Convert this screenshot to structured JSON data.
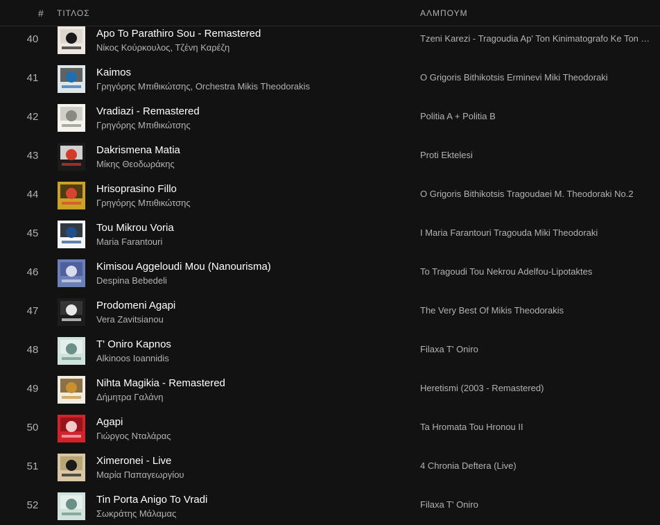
{
  "header": {
    "number": "#",
    "title": "ΤΙΤΛΟΣ",
    "album": "ΑΛΜΠΟΥΜ"
  },
  "tracks": [
    {
      "number": "40",
      "title": "Apo To Parathiro Sou - Remastered",
      "artist": "Νίκος Κούρκουλος, Τζένη Καρέζη",
      "album": "Tzeni Karezi - Tragoudia Ap' Ton Kinimatografo Ke Ton Theatro",
      "cover": {
        "bg": "#ede9e2",
        "accent": "#1a1a1a",
        "band": "#d9d3c9"
      }
    },
    {
      "number": "41",
      "title": "Kaimos",
      "artist": "Γρηγόρης Μπιθικώτσης, Orchestra Mikis Theodorakis",
      "album": "O Grigoris Bithikotsis Erminevi Miki Theodoraki",
      "cover": {
        "bg": "#dfe6ea",
        "accent": "#1f6fb0",
        "band": "#4a4a4a"
      }
    },
    {
      "number": "42",
      "title": "Vradiazi - Remastered",
      "artist": "Γρηγόρης Μπιθικώτσης",
      "album": "Politia A + Politia B",
      "cover": {
        "bg": "#f4f3ee",
        "accent": "#8a8a80",
        "band": "#c9c8c0"
      }
    },
    {
      "number": "43",
      "title": "Dakrismena Matia",
      "artist": "Μίκης Θεοδωράκης",
      "album": "Proti Ektelesi",
      "cover": {
        "bg": "#1b1b1b",
        "accent": "#d23a2a",
        "band": "#f0f0f0"
      }
    },
    {
      "number": "44",
      "title": "Hrisoprasino Fillo",
      "artist": "Γρηγόρης Μπιθικώτσης",
      "album": "O Grigoris Bithikotsis Tragoudaei M. Theodoraki No.2",
      "cover": {
        "bg": "#c9a227",
        "accent": "#d8452e",
        "band": "#3a2a10"
      }
    },
    {
      "number": "45",
      "title": "Tou Mikrou Voria",
      "artist": "Maria Farantouri",
      "album": "I Maria Farantouri Tragouda Miki Theodoraki",
      "cover": {
        "bg": "#f2f4f6",
        "accent": "#1f4f8a",
        "band": "#101820"
      }
    },
    {
      "number": "46",
      "title": "Kimisou Aggeloudi Mou (Nanourisma)",
      "artist": "Despina Bebedeli",
      "album": "To Tragoudi Tou Nekrou Adelfou-Lipotaktes",
      "cover": {
        "bg": "#6b7fb8",
        "accent": "#d9dcea",
        "band": "#4a5b94"
      }
    },
    {
      "number": "47",
      "title": "Prodomeni Agapi",
      "artist": "Vera Zavitsianou",
      "album": "The Very Best Of Mikis Theodorakis",
      "cover": {
        "bg": "#1c1c1c",
        "accent": "#e8e8e8",
        "band": "#3a3a3a"
      }
    },
    {
      "number": "48",
      "title": "T' Oniro Kapnos",
      "artist": "Alkinoos Ioannidis",
      "album": "Filaxa T' Oniro",
      "cover": {
        "bg": "#cfe3dc",
        "accent": "#6a8f86",
        "band": "#e8f1ee"
      }
    },
    {
      "number": "49",
      "title": "Nihta Magikia - Remastered",
      "artist": "Δήμητρα Γαλάνη",
      "album": "Heretismi (2003 - Remastered)",
      "cover": {
        "bg": "#f1ece0",
        "accent": "#c7912e",
        "band": "#7a5a2a"
      }
    },
    {
      "number": "50",
      "title": "Agapi",
      "artist": "Γιώργος Νταλάρας",
      "album": "Ta Hromata Tou Hronou II",
      "cover": {
        "bg": "#d3222c",
        "accent": "#f2c8c8",
        "band": "#8e1218"
      }
    },
    {
      "number": "51",
      "title": "Ximeronei - Live",
      "artist": "Μαρία Παπαγεωργίου",
      "album": "4 Chronia Deftera (Live)",
      "cover": {
        "bg": "#d8c7a2",
        "accent": "#1a1a1a",
        "band": "#b59f72"
      }
    },
    {
      "number": "52",
      "title": "Tin Porta Anigo To Vradi",
      "artist": "Σωκράτης Μάλαμας",
      "album": "Filaxa T' Oniro",
      "cover": {
        "bg": "#cfe3dc",
        "accent": "#6a8f86",
        "band": "#e8f1ee"
      }
    }
  ]
}
